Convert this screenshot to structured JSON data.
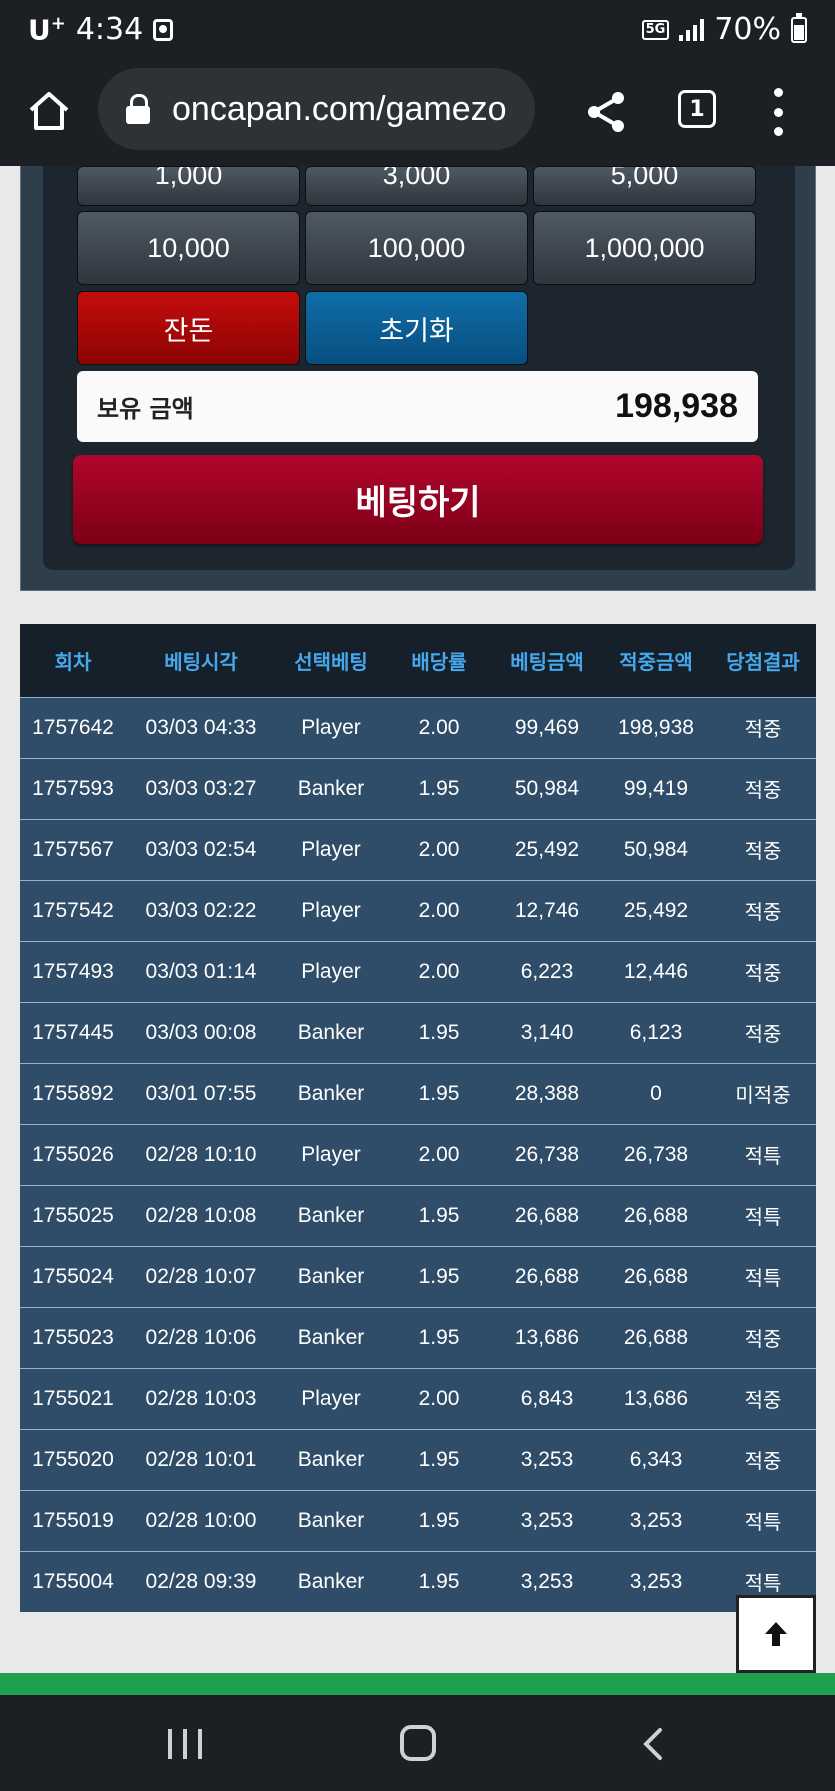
{
  "status_bar": {
    "carrier": "U",
    "carrier_sup": "+",
    "time": "4:34",
    "network": "5G",
    "battery": "70%"
  },
  "browser": {
    "url": "oncapan.com/gamezo",
    "tab_count": "1"
  },
  "bet_panel": {
    "amount_buttons_top": [
      "1,000",
      "3,000",
      "5,000"
    ],
    "amount_buttons": [
      "10,000",
      "100,000",
      "1,000,000"
    ],
    "jandon_label": "잔돈",
    "reset_label": "초기화",
    "balance_label": "보유 금액",
    "balance_value": "198,938",
    "bet_button_label": "베팅하기"
  },
  "history": {
    "headers": [
      "회차",
      "베팅시각",
      "선택베팅",
      "배당률",
      "베팅금액",
      "적중금액",
      "당첨결과"
    ],
    "rows": [
      {
        "round": "1757642",
        "time": "03/03 04:33",
        "pick": "Player",
        "odds": "2.00",
        "bet": "99,469",
        "win": "198,938",
        "result": "적중",
        "status": "hit"
      },
      {
        "round": "1757593",
        "time": "03/03 03:27",
        "pick": "Banker",
        "odds": "1.95",
        "bet": "50,984",
        "win": "99,419",
        "result": "적중",
        "status": "hit"
      },
      {
        "round": "1757567",
        "time": "03/03 02:54",
        "pick": "Player",
        "odds": "2.00",
        "bet": "25,492",
        "win": "50,984",
        "result": "적중",
        "status": "hit"
      },
      {
        "round": "1757542",
        "time": "03/03 02:22",
        "pick": "Player",
        "odds": "2.00",
        "bet": "12,746",
        "win": "25,492",
        "result": "적중",
        "status": "hit"
      },
      {
        "round": "1757493",
        "time": "03/03 01:14",
        "pick": "Player",
        "odds": "2.00",
        "bet": "6,223",
        "win": "12,446",
        "result": "적중",
        "status": "hit"
      },
      {
        "round": "1757445",
        "time": "03/03 00:08",
        "pick": "Banker",
        "odds": "1.95",
        "bet": "3,140",
        "win": "6,123",
        "result": "적중",
        "status": "hit"
      },
      {
        "round": "1755892",
        "time": "03/01 07:55",
        "pick": "Banker",
        "odds": "1.95",
        "bet": "28,388",
        "win": "0",
        "result": "미적중",
        "status": "miss"
      },
      {
        "round": "1755026",
        "time": "02/28 10:10",
        "pick": "Player",
        "odds": "2.00",
        "bet": "26,738",
        "win": "26,738",
        "result": "적특",
        "status": "hit"
      },
      {
        "round": "1755025",
        "time": "02/28 10:08",
        "pick": "Banker",
        "odds": "1.95",
        "bet": "26,688",
        "win": "26,688",
        "result": "적특",
        "status": "hit"
      },
      {
        "round": "1755024",
        "time": "02/28 10:07",
        "pick": "Banker",
        "odds": "1.95",
        "bet": "26,688",
        "win": "26,688",
        "result": "적특",
        "status": "hit"
      },
      {
        "round": "1755023",
        "time": "02/28 10:06",
        "pick": "Banker",
        "odds": "1.95",
        "bet": "13,686",
        "win": "26,688",
        "result": "적중",
        "status": "hit"
      },
      {
        "round": "1755021",
        "time": "02/28 10:03",
        "pick": "Player",
        "odds": "2.00",
        "bet": "6,843",
        "win": "13,686",
        "result": "적중",
        "status": "hit"
      },
      {
        "round": "1755020",
        "time": "02/28 10:01",
        "pick": "Banker",
        "odds": "1.95",
        "bet": "3,253",
        "win": "6,343",
        "result": "적중",
        "status": "hit"
      },
      {
        "round": "1755019",
        "time": "02/28 10:00",
        "pick": "Banker",
        "odds": "1.95",
        "bet": "3,253",
        "win": "3,253",
        "result": "적특",
        "status": "hit"
      },
      {
        "round": "1755004",
        "time": "02/28 09:39",
        "pick": "Banker",
        "odds": "1.95",
        "bet": "3,253",
        "win": "3,253",
        "result": "적특",
        "status": "hit"
      }
    ]
  },
  "icons": {
    "scroll_top": "arrow-up-icon",
    "home": "home-icon",
    "share": "share-icon",
    "menu": "more-vertical-icon"
  },
  "colors": {
    "header_text": "#47a7ea",
    "result_hit": "#f5a623",
    "result_miss": "#d8111b",
    "row_bg": "#2f4c68",
    "bet_button": "#9b0524"
  }
}
